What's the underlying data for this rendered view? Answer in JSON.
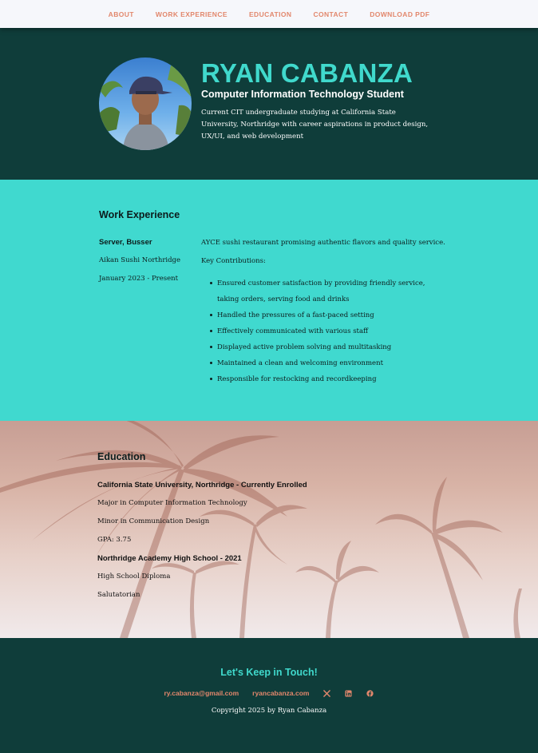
{
  "nav": {
    "items": [
      "ABOUT",
      "WORK EXPERIENCE",
      "EDUCATION",
      "CONTACT",
      "DOWNLOAD PDF"
    ]
  },
  "hero": {
    "name": "RYAN CABANZA",
    "subtitle": "Computer Information Technology Student",
    "bio": "Current CIT undergraduate studying at California State University, Northridge with career aspirations in product design, UX/UI, and web development"
  },
  "work": {
    "title": "Work Experience",
    "job": {
      "title": "Server, Busser",
      "company": "Aikan Sushi Northridge",
      "dates": "January 2023 - Present",
      "description": "AYCE sushi restaurant promising authentic flavors and quality service.",
      "contributions_label": "Key Contributions:",
      "contributions": [
        "Ensured customer satisfaction by providing friendly service, taking orders, serving food and drinks",
        "Handled the pressures of a fast-paced setting",
        "Effectively communicated with various staff",
        "Displayed active problem solving and multitasking",
        "Maintained a clean and welcoming environment",
        "Responsible for restocking and recordkeeping"
      ]
    }
  },
  "education": {
    "title": "Education",
    "schools": [
      {
        "name": "California State University, Northridge - Currently Enrolled",
        "lines": [
          "Major in Computer Information Technology",
          "Minor in Communication Design",
          "GPA: 3.75"
        ]
      },
      {
        "name": "Northridge Academy High School - 2021",
        "lines": [
          "High School Diploma",
          "Salutatorian"
        ]
      }
    ]
  },
  "footer": {
    "title": "Let's Keep in Touch!",
    "email": "ry.cabanza@gmail.com",
    "website": "ryancabanza.com",
    "social_icons": [
      "x-icon",
      "linkedin-icon",
      "facebook-icon"
    ],
    "copyright": "Copyright 2025 by Ryan Cabanza"
  },
  "colors": {
    "dark_teal": "#0f3d3a",
    "aqua": "#40d9cf",
    "accent_salmon": "#e2876c",
    "nav_bg": "#f6f7fb"
  }
}
